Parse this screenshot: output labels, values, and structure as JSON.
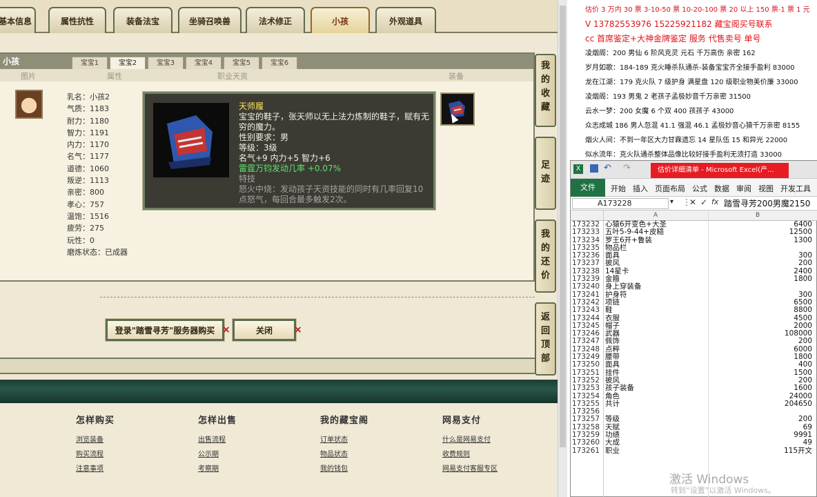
{
  "top_tabs": [
    "基本信息",
    "属性抗性",
    "装备法宝",
    "坐骑召唤兽",
    "法术修正",
    "小孩",
    "外观道具"
  ],
  "panel": {
    "title": "小孩",
    "baby_tabs": [
      "宝宝1",
      "宝宝2",
      "宝宝3",
      "宝宝4",
      "宝宝5",
      "宝宝6"
    ],
    "col_headers": {
      "picture": "图片",
      "attrs": "属性",
      "talent": "职业天资",
      "equip": "装备"
    },
    "stats": [
      "乳名：小孩2",
      "气质：1183",
      "耐力：1180",
      "智力：1191",
      "内力：1170",
      "名气：1177",
      "道德：1060",
      "叛逆：1113",
      "亲密：800",
      "孝心：757",
      "温饱：1516",
      "疲劳：275",
      "玩性：0",
      "磨炼状态：已成器"
    ]
  },
  "tooltip": {
    "name": "天师履",
    "desc": "宝宝的鞋子，张天师以无上法力炼制的鞋子，赋有无穷的魔力。",
    "gender": "性别要求：男",
    "level": "等级：3级",
    "bonus": "名气+9 内力+5 智力+6",
    "green": "雷霆万钧发动几率 +0.07%",
    "special_title": "特技",
    "special_desc": "怒火中烧：发动孩子天资技能的同时有几率回复10点怒气，每回合最多触发2次。"
  },
  "buttons": {
    "buy": "登录\"踏雪寻芳\"服务器购买",
    "close": "关闭"
  },
  "side_nav": [
    "我的收藏",
    "足迹",
    "我的还价",
    "返回顶部"
  ],
  "footer": {
    "cols": [
      {
        "title": "怎样购买",
        "links": [
          "浏览装备",
          "购买流程",
          "注意事项"
        ]
      },
      {
        "title": "怎样出售",
        "links": [
          "出售流程",
          "公示期",
          "考察期"
        ]
      },
      {
        "title": "我的藏宝阁",
        "links": [
          "订单状态",
          "物品状态",
          "我的钱包"
        ]
      },
      {
        "title": "网易支付",
        "links": [
          "什么是网易支付",
          "收费规则",
          "网易支付客服专区"
        ]
      }
    ]
  },
  "notes": [
    {
      "text": "估价 3 万内 30 票 3-10-50 票 10-20-100 票 20 以上 150 票-1 票 1 元",
      "style": "red"
    },
    {
      "text": "V 13782553976  15225921182  藏宝阁买号联系",
      "style": "red2"
    },
    {
      "text": "cc 首席鉴定+大神金牌鉴定 服务 代售卖号 单号",
      "style": "red2"
    },
    {
      "text": "凌烟阁：200 男仙 6 阶风克灵 元石 千万高伤 亲密 162",
      "style": "black"
    },
    {
      "text": "岁月如歌：184-189 克火睡杀队通杀-装备宝宝齐全接手盈利 83000",
      "style": "black"
    },
    {
      "text": "龙在江湖：179 克火队 7 级护身 满星盘 120 级职业物美价廉 33000",
      "style": "black"
    },
    {
      "text": "凌烟阁：193 男鬼 2 老孩子孟极妙音千万亲密 31500",
      "style": "black"
    },
    {
      "text": "云水一梦：200 女魔 6 个双 400 孩孩子 43000",
      "style": "black"
    },
    {
      "text": "众志成城 186 男人忽混 41.1 强混 46.1 孟极妙音心猿千万亲密 8155",
      "style": "black"
    },
    {
      "text": "烟火人间：不到一年区大力甘霖遗忘 14 星队伍 15 和异光 22000",
      "style": "black"
    },
    {
      "text": "似水流年：克火队通杀整体品像比较好接手盈利无须打造 33000",
      "style": "black"
    }
  ],
  "excel": {
    "title": "估价详细清单 - Microsoft Excel(产...",
    "ribbon_tabs": [
      "文件",
      "开始",
      "插入",
      "页面布局",
      "公式",
      "数据",
      "审阅",
      "视图",
      "开发工具"
    ],
    "name_box": "A173228",
    "formula": "踏雪寻芳200男魔2150",
    "col_a": "A",
    "col_b": "B",
    "rows": [
      [
        "173232",
        "心猿6开变色+大圣",
        "6400"
      ],
      [
        "173233",
        "五叶5-9-44+皮糙",
        "12500"
      ],
      [
        "173234",
        "罗王6开+鲁装",
        "1300"
      ],
      [
        "173235",
        "物品栏",
        ""
      ],
      [
        "173236",
        "面具",
        "300"
      ],
      [
        "173237",
        "披风",
        "200"
      ],
      [
        "173238",
        "14星卡",
        "2400"
      ],
      [
        "173239",
        "金箍",
        "1800"
      ],
      [
        "173240",
        "身上穿装备",
        ""
      ],
      [
        "173241",
        "护身符",
        "300"
      ],
      [
        "173242",
        "项链",
        "6500"
      ],
      [
        "173243",
        "鞋",
        "8800"
      ],
      [
        "173244",
        "衣服",
        "4500"
      ],
      [
        "173245",
        "帽子",
        "2000"
      ],
      [
        "173246",
        "武器",
        "108000"
      ],
      [
        "173247",
        "佩饰",
        "200"
      ],
      [
        "173248",
        "点粹",
        "6000"
      ],
      [
        "173249",
        "腰带",
        "1800"
      ],
      [
        "173250",
        "面具",
        "400"
      ],
      [
        "173251",
        "挂件",
        "1500"
      ],
      [
        "173252",
        "披风",
        "200"
      ],
      [
        "173253",
        "孩子装备",
        "1600"
      ],
      [
        "173254",
        "角色",
        "24000"
      ],
      [
        "173255",
        "共计",
        "204650"
      ],
      [
        "173256",
        "",
        ""
      ],
      [
        "173257",
        "等级",
        "200"
      ],
      [
        "173258",
        "天赋",
        "69"
      ],
      [
        "173259",
        "功绩",
        "9991"
      ],
      [
        "173260",
        "大成",
        "49"
      ],
      [
        "173261",
        "职业",
        "115开文"
      ]
    ]
  },
  "watermark": {
    "line1": "激活 Windows",
    "line2": "转到“设置”以激活 Windows。"
  }
}
